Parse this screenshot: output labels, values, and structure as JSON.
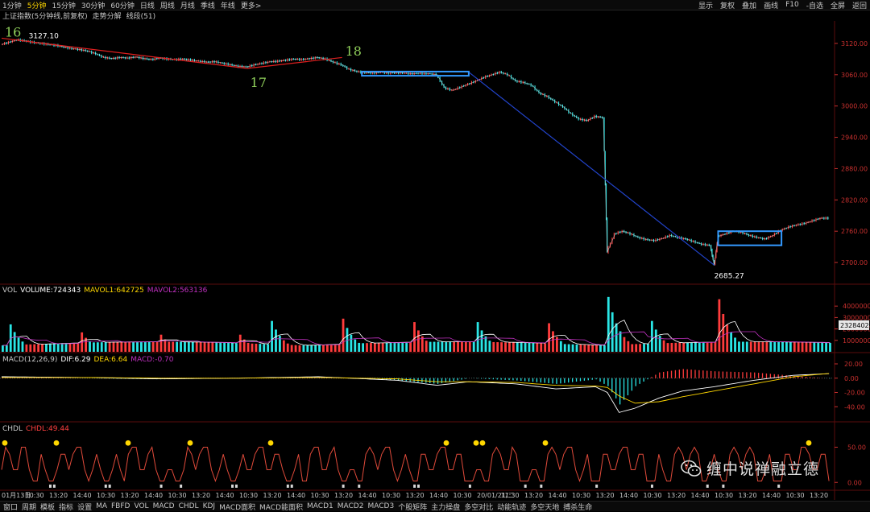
{
  "toolbar": {
    "timeframes": [
      {
        "label": "1分钟",
        "active": false
      },
      {
        "label": "5分钟",
        "active": true
      },
      {
        "label": "15分钟",
        "active": false
      },
      {
        "label": "30分钟",
        "active": false
      },
      {
        "label": "60分钟",
        "active": false
      },
      {
        "label": "日线",
        "active": false
      },
      {
        "label": "周线",
        "active": false
      },
      {
        "label": "月线",
        "active": false
      },
      {
        "label": "季线",
        "active": false
      },
      {
        "label": "年线",
        "active": false
      },
      {
        "label": "更多>",
        "active": false
      }
    ],
    "right_items": [
      "显示",
      "复权",
      "叠加",
      "画线",
      "F10",
      "-自选",
      "全屏",
      "返回"
    ]
  },
  "title": {
    "name": "上证指数(5分钟线,前复权)",
    "item1": "走势分解",
    "item2": "线段(51)"
  },
  "colors": {
    "up": "#ff3c3c",
    "down": "#29e6e6",
    "price_line": "#ffffff",
    "trend_red": "#e02020",
    "trend_blue": "#2244cc",
    "box": "#3399ff",
    "mavol1": "#ffd700",
    "mavol2": "#c030c0",
    "dea": "#ffd700",
    "dif": "#ffffff",
    "grid": "#7a1010",
    "axis_text": "#c8302e",
    "label_green": "#8fcf5a"
  },
  "chart_data": [
    {
      "type": "line",
      "name": "price",
      "ylim": [
        2660,
        3160
      ],
      "y_ticks": [
        "3120.00",
        "3060.00",
        "3000.00",
        "2940.00",
        "2880.00",
        "2820.00",
        "2760.00",
        "2700.00"
      ],
      "y_tick_values": [
        3120,
        3060,
        3000,
        2940,
        2880,
        2820,
        2760,
        2700
      ],
      "points": [
        [
          0,
          3118
        ],
        [
          2,
          3122
        ],
        [
          4,
          3127.1
        ],
        [
          6,
          3125
        ],
        [
          8,
          3122
        ],
        [
          10,
          3120
        ],
        [
          12,
          3118
        ],
        [
          14,
          3116
        ],
        [
          16,
          3113
        ],
        [
          18,
          3110
        ],
        [
          20,
          3108
        ],
        [
          22,
          3105
        ],
        [
          24,
          3100
        ],
        [
          26,
          3093
        ],
        [
          28,
          3091
        ],
        [
          30,
          3093
        ],
        [
          32,
          3092
        ],
        [
          34,
          3094
        ],
        [
          36,
          3091
        ],
        [
          38,
          3089
        ],
        [
          40,
          3092
        ],
        [
          42,
          3090
        ],
        [
          44,
          3089
        ],
        [
          46,
          3090
        ],
        [
          48,
          3088
        ],
        [
          50,
          3086
        ],
        [
          52,
          3084
        ],
        [
          54,
          3085
        ],
        [
          56,
          3082
        ],
        [
          58,
          3079
        ],
        [
          60,
          3076
        ],
        [
          62,
          3075
        ],
        [
          64,
          3079
        ],
        [
          66,
          3082
        ],
        [
          68,
          3085
        ],
        [
          70,
          3086
        ],
        [
          72,
          3088
        ],
        [
          74,
          3090
        ],
        [
          76,
          3089
        ],
        [
          78,
          3091
        ],
        [
          80,
          3093
        ],
        [
          82,
          3090
        ],
        [
          84,
          3084
        ],
        [
          86,
          3079
        ],
        [
          88,
          3070
        ],
        [
          90,
          3066
        ],
        [
          92,
          3064
        ],
        [
          94,
          3063
        ],
        [
          96,
          3065
        ],
        [
          98,
          3063
        ],
        [
          100,
          3064
        ],
        [
          102,
          3063
        ],
        [
          104,
          3062
        ],
        [
          106,
          3063
        ],
        [
          108,
          3062
        ],
        [
          110,
          3060
        ],
        [
          112,
          3035
        ],
        [
          114,
          3030
        ],
        [
          116,
          3036
        ],
        [
          118,
          3042
        ],
        [
          120,
          3048
        ],
        [
          122,
          3055
        ],
        [
          124,
          3060
        ],
        [
          126,
          3065
        ],
        [
          128,
          3060
        ],
        [
          130,
          3048
        ],
        [
          132,
          3045
        ],
        [
          134,
          3040
        ],
        [
          136,
          3025
        ],
        [
          138,
          3018
        ],
        [
          140,
          3008
        ],
        [
          142,
          2998
        ],
        [
          144,
          2985
        ],
        [
          146,
          2975
        ],
        [
          148,
          2972
        ],
        [
          150,
          2980
        ],
        [
          152,
          2978
        ],
        [
          153,
          2720
        ],
        [
          155,
          2755
        ],
        [
          157,
          2760
        ],
        [
          159,
          2755
        ],
        [
          161,
          2748
        ],
        [
          163,
          2744
        ],
        [
          165,
          2742
        ],
        [
          167,
          2746
        ],
        [
          169,
          2752
        ],
        [
          171,
          2748
        ],
        [
          173,
          2745
        ],
        [
          175,
          2740
        ],
        [
          177,
          2735
        ],
        [
          179,
          2733
        ],
        [
          180,
          2695
        ],
        [
          181,
          2750
        ],
        [
          183,
          2755
        ],
        [
          185,
          2760
        ],
        [
          187,
          2758
        ],
        [
          189,
          2752
        ],
        [
          191,
          2748
        ],
        [
          193,
          2745
        ],
        [
          195,
          2752
        ],
        [
          197,
          2762
        ],
        [
          199,
          2768
        ],
        [
          201,
          2772
        ],
        [
          203,
          2775
        ],
        [
          205,
          2780
        ],
        [
          207,
          2785
        ],
        [
          209,
          2785
        ]
      ],
      "annotations": [
        {
          "text": "16",
          "x": 0,
          "y": 3130
        },
        {
          "text": "17",
          "x": 62,
          "y": 3055
        },
        {
          "text": "18",
          "x": 86,
          "y": 3094
        },
        {
          "text": "3127.10",
          "x": 4,
          "y": 3127.1
        },
        {
          "text": "2685.27",
          "x": 180,
          "y": 2685.27
        }
      ],
      "trend_lines": [
        {
          "color": "red",
          "from": [
            0,
            3130
          ],
          "to": [
            62,
            3072
          ]
        },
        {
          "color": "red",
          "from": [
            62,
            3072
          ],
          "to": [
            86,
            3093
          ]
        },
        {
          "color": "blue",
          "from": [
            118,
            3065
          ],
          "to": [
            180,
            2695
          ]
        }
      ],
      "boxes": [
        {
          "x0": 91,
          "x1": 118,
          "y0": 3058,
          "y1": 3066
        },
        {
          "x0": 181,
          "x1": 197,
          "y0": 2733,
          "y1": 2760
        }
      ]
    },
    {
      "type": "bar",
      "name": "volume",
      "labels": {
        "vol": "VOL",
        "volume": "VOLUME:724343",
        "mavol1": "MAVOL1:642725",
        "mavol2": "MAVOL2:563136"
      },
      "ylim": [
        0,
        5000000
      ],
      "y_ticks": [
        "4000000",
        "3000000",
        "2000000",
        "1000000"
      ],
      "y_tick_values": [
        4000000,
        3000000,
        2000000,
        1000000
      ],
      "current_value": "2328402",
      "spikes": [
        {
          "x": 2,
          "v": 2400000
        },
        {
          "x": 20,
          "v": 1700000
        },
        {
          "x": 40,
          "v": 1500000
        },
        {
          "x": 60,
          "v": 1500000
        },
        {
          "x": 68,
          "v": 2700000
        },
        {
          "x": 86,
          "v": 2900000
        },
        {
          "x": 104,
          "v": 2600000
        },
        {
          "x": 120,
          "v": 2600000
        },
        {
          "x": 138,
          "v": 2500000
        },
        {
          "x": 153,
          "v": 4800000
        },
        {
          "x": 164,
          "v": 2700000
        },
        {
          "x": 181,
          "v": 4600000
        }
      ],
      "base": 800000
    },
    {
      "type": "line",
      "name": "macd",
      "labels": {
        "macd": "MACD(12,26,9)",
        "dif": "DIF:6.29",
        "dea": "DEA:6.64",
        "macdv": "MACD:-0.70"
      },
      "ylim": [
        -60,
        20
      ],
      "y_ticks": [
        "20.00",
        "0.00",
        "-20.00",
        "-40.00"
      ],
      "y_tick_values": [
        20,
        0,
        -20,
        -40
      ],
      "dif": [
        [
          0,
          2
        ],
        [
          20,
          1
        ],
        [
          40,
          -1
        ],
        [
          60,
          0
        ],
        [
          80,
          2
        ],
        [
          100,
          -3
        ],
        [
          110,
          -10
        ],
        [
          118,
          -5
        ],
        [
          130,
          -8
        ],
        [
          140,
          -15
        ],
        [
          150,
          -12
        ],
        [
          153,
          -20
        ],
        [
          156,
          -48
        ],
        [
          160,
          -42
        ],
        [
          166,
          -28
        ],
        [
          172,
          -18
        ],
        [
          180,
          -12
        ],
        [
          190,
          -3
        ],
        [
          200,
          4
        ],
        [
          209,
          6.29
        ]
      ],
      "dea": [
        [
          0,
          1
        ],
        [
          20,
          1
        ],
        [
          40,
          0
        ],
        [
          60,
          0
        ],
        [
          80,
          1
        ],
        [
          100,
          -1
        ],
        [
          110,
          -5
        ],
        [
          118,
          -5
        ],
        [
          130,
          -6
        ],
        [
          140,
          -10
        ],
        [
          150,
          -11
        ],
        [
          153,
          -13
        ],
        [
          156,
          -25
        ],
        [
          160,
          -35
        ],
        [
          166,
          -33
        ],
        [
          172,
          -26
        ],
        [
          180,
          -18
        ],
        [
          190,
          -8
        ],
        [
          200,
          2
        ],
        [
          209,
          6.64
        ]
      ]
    },
    {
      "type": "line",
      "name": "chdl",
      "labels": {
        "chdl": "CHDL",
        "value": "CHDL:49.44"
      },
      "ylim": [
        -10,
        70
      ],
      "y_ticks": [
        "50.00",
        "0.00"
      ],
      "y_tick_values": [
        50,
        0
      ],
      "x_ticks": [
        "01月13日",
        "10:30",
        "13:20",
        "14:40",
        "10:30",
        "13:20",
        "14:40",
        "10:30",
        "13:20",
        "14:40",
        "10:30",
        "13:20",
        "14:40",
        "10:30",
        "13:20",
        "14:40",
        "10:30",
        "13:20",
        "14:40",
        "10:30",
        "20/01/21/二",
        "11:30",
        "13:20",
        "14:40",
        "10:30",
        "13:20",
        "14:40",
        "10:30",
        "13:20",
        "14:40",
        "10:30",
        "13:20",
        "14:40",
        "10:30",
        "13:20"
      ]
    }
  ],
  "bottom_tabs": [
    "窗口",
    "周期",
    "模板",
    "指标",
    "设置",
    "MA",
    "FBFD",
    "VOL",
    "MACD",
    "CHDL",
    "KDJ",
    "MACD面积",
    "MACD能面积",
    "MACD1",
    "MACD2",
    "MACD3",
    "个股矩阵",
    "主力操盘",
    "多空对比",
    "动能轨迹",
    "多空天地",
    "搏杀生命"
  ],
  "watermark": {
    "text": "缠中说禅融立德",
    "icon": "wechat-icon"
  }
}
